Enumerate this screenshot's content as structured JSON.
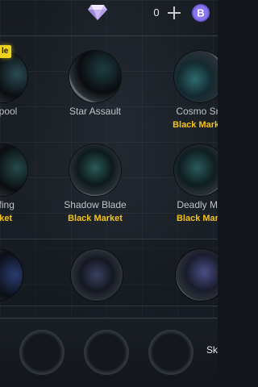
{
  "topbar": {
    "gem_icon": "diamond-gem-icon",
    "gem_count": "0",
    "plus_icon": "plus-icon",
    "currency_icon": "b-coin-icon"
  },
  "skins": {
    "sale_badge": "le",
    "row1": [
      {
        "name": "hirlpool",
        "market": ""
      },
      {
        "name": "Star Assault",
        "market": ""
      },
      {
        "name": "Cosmo Sm",
        "market": "Black Market"
      }
    ],
    "row2": [
      {
        "name": "luffing",
        "market": "arket"
      },
      {
        "name": "Shadow Blade",
        "market": "Black Market"
      },
      {
        "name": "Deadly Ma",
        "market": "Black Mark"
      }
    ]
  },
  "equip": {
    "label": "Sk"
  },
  "colors": {
    "market_gold": "#f2c21b",
    "background": "#171c22",
    "sale_yellow": "#f0d21e"
  }
}
